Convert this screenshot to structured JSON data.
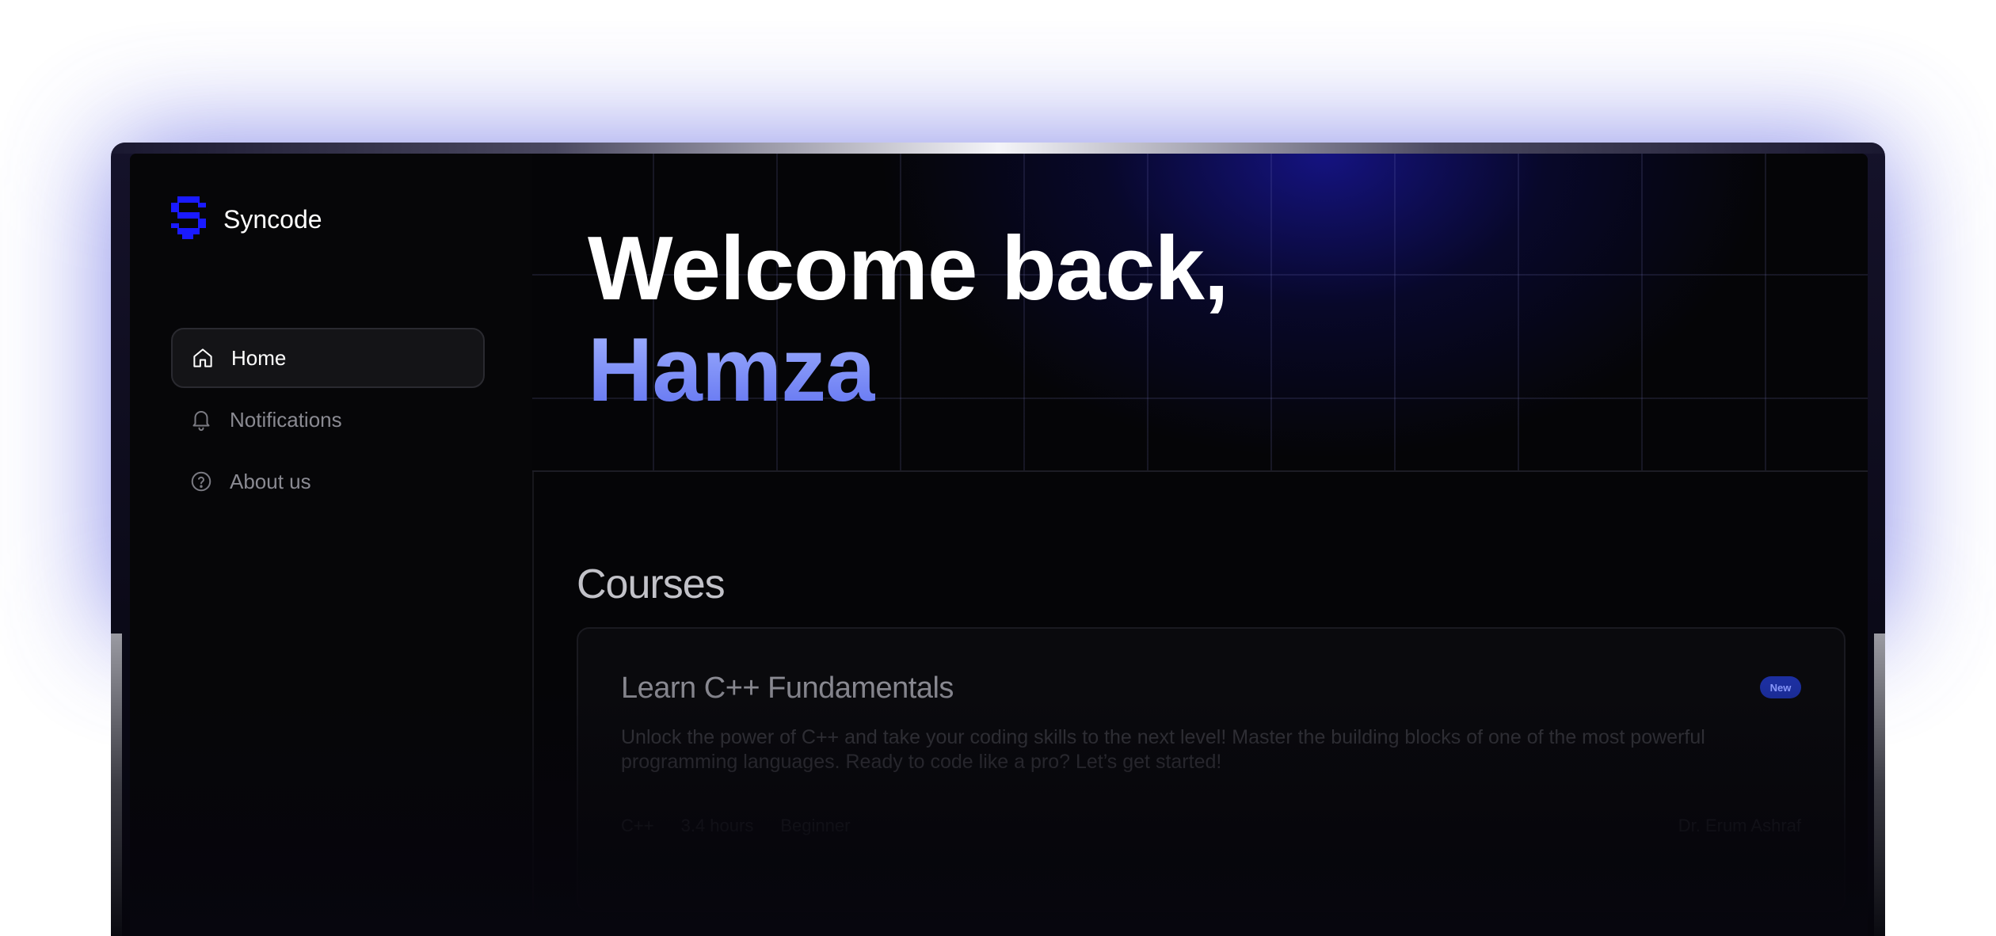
{
  "brand": {
    "name": "Syncode",
    "logo_color": "#1a1aff"
  },
  "sidebar": {
    "items": [
      {
        "label": "Home",
        "icon": "home-icon",
        "active": true
      },
      {
        "label": "Notifications",
        "icon": "bell-icon",
        "active": false
      },
      {
        "label": "About us",
        "icon": "help-circle-icon",
        "active": false
      }
    ]
  },
  "hero": {
    "line1": "Welcome back,",
    "line2": "Hamza"
  },
  "courses": {
    "title": "Courses",
    "items": [
      {
        "title": "Learn C++ Fundamentals",
        "badge": "New",
        "description": "Unlock the power of C++ and take your coding skills to the next level! Master the building blocks of one of the most powerful programming languages. Ready to code like a pro? Let’s get started!",
        "tags": [
          "C++",
          "3.4 hours",
          "Beginner"
        ],
        "author": "Dr. Erum Ashraf"
      }
    ]
  },
  "colors": {
    "accent": "#5d6ff0",
    "glow": "#5a5fe0",
    "badge": "#1c2fa0"
  }
}
